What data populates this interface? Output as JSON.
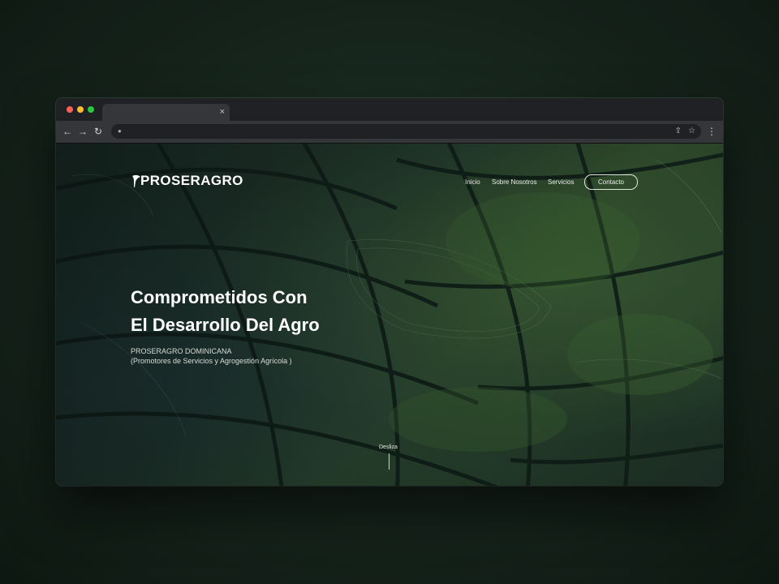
{
  "browser": {
    "tab_close": "×",
    "icons": {
      "back": "arrow-left",
      "forward": "arrow-right",
      "reload": "reload",
      "lock": "lock",
      "share": "share",
      "bookmark": "star",
      "menu": "kebab"
    },
    "glyphs": {
      "back": "←",
      "forward": "→",
      "reload": "↻",
      "lock": "●",
      "share": "⇧",
      "bookmark": "☆",
      "menu": "⋮"
    }
  },
  "site": {
    "logo": "PROSERAGRO",
    "nav": {
      "items": [
        "Inicio",
        "Sobre Nosotros",
        "Servicios"
      ],
      "cta": "Contacto"
    },
    "hero": {
      "title_line1": "Comprometidos Con",
      "title_line2": "El Desarrollo Del Agro",
      "subtitle_line1": "PROSERAGRO DOMINICANA",
      "subtitle_line2": "(Promotores de Servicios y Agrogestión Agrícola )"
    },
    "scroll_hint": "Desliza"
  },
  "colors": {
    "page_background": "#15231b",
    "browser_chrome": "#202124",
    "toolbar": "#35363a",
    "hero_text": "#ffffff",
    "accent_green": "#2e4a2a"
  }
}
